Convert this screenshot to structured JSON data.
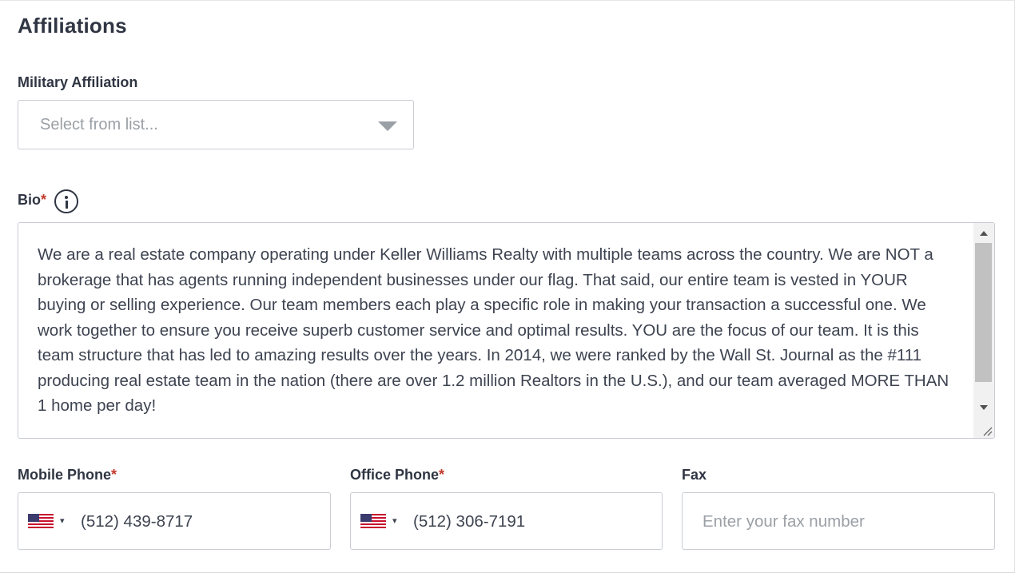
{
  "section": {
    "title": "Affiliations"
  },
  "military": {
    "label": "Military Affiliation",
    "placeholder": "Select from list..."
  },
  "bio": {
    "label": "Bio",
    "required_mark": "*",
    "text": "We are a real estate company operating under Keller Williams Realty with multiple teams across the country. We are NOT a brokerage that has agents running independent businesses under our flag. That said, our entire team is vested in YOUR buying or selling experience. Our team members each play a specific role in making your transaction a successful one. We work together to ensure you receive superb customer service and optimal results. YOU are the focus of our team. It is this team structure that has led to amazing results over the years. In 2014, we were ranked by the Wall St. Journal as the #111 producing real estate team in the nation (there are over 1.2 million Realtors in the U.S.), and our team averaged MORE THAN 1 home per day!"
  },
  "mobile_phone": {
    "label": "Mobile Phone",
    "required_mark": "*",
    "country_caret": "▾",
    "value": "(512) 439-8717"
  },
  "office_phone": {
    "label": "Office Phone",
    "required_mark": "*",
    "country_caret": "▾",
    "value": "(512) 306-7191"
  },
  "fax": {
    "label": "Fax",
    "placeholder": "Enter your fax number"
  },
  "icons": {
    "info": "info-circle-icon",
    "flag": "us-flag-icon",
    "dropdown": "chevron-down-icon"
  },
  "colors": {
    "required": "#c0392b",
    "text": "#2f3542",
    "placeholder": "#9aa0a6",
    "border": "#c9cdd3"
  }
}
